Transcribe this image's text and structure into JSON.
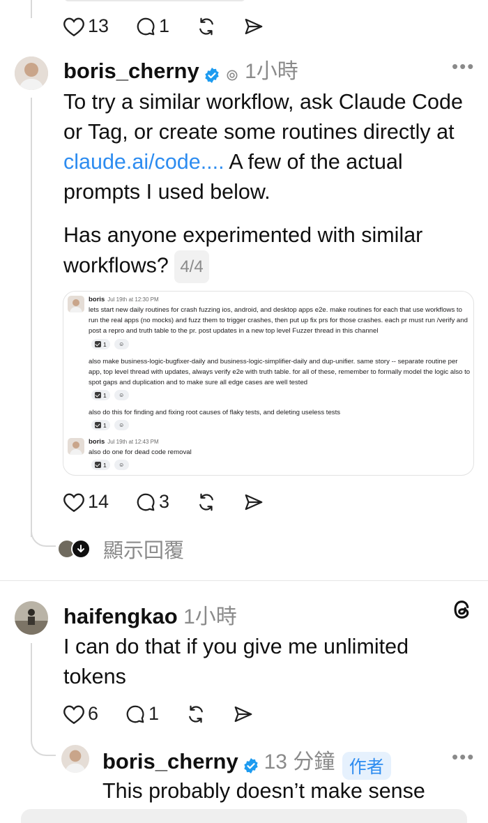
{
  "top_actions": {
    "likes": "13",
    "replies": "1"
  },
  "post1": {
    "username": "boris_cherny",
    "time": "1小時",
    "text_a": "To try a similar workflow, ask Claude Code or Tag, or create some routines directly at ",
    "link": "claude.ai/code....",
    "text_b": " A few of the actual prompts I used below.",
    "text2": "Has anyone experimented with similar workflows? ",
    "page_indicator": "4/4",
    "likes": "14",
    "replies": "3",
    "show_replies": "顯示回覆"
  },
  "slack": {
    "msg1_name": "boris",
    "msg1_time": "Jul 19th at 12:30 PM",
    "msg1_text": "lets start new daily routines for crash fuzzing ios, android, and desktop apps e2e. make routines for each that use workflows to run the real apps (no mocks) and fuzz them to trigger crashes, then put up fix prs for those crashes. each pr must run /verify and post a repro and truth table to the pr. post updates in a new top level Fuzzer thread in this channel",
    "msg2_text": "also make business-logic-bugfixer-daily and business-logic-simplifier-daily and  dup-unifier. same story -- separate routine per app, top level thread with updates, always verify e2e with truth table. for all of these, remember to formally model the logic also to spot gaps and duplication and to make sure all edge cases are well tested",
    "msg3_text": "also do this for finding and fixing root causes of flaky tests, and deleting useless tests",
    "msg4_name": "boris",
    "msg4_time": "Jul 19th at 12:43 PM",
    "msg4_text": "also do one for dead code removal",
    "reaction_count": "1"
  },
  "post2": {
    "username": "haifengkao",
    "time": "1小時",
    "text": "I can do that if you give me unlimited tokens",
    "likes": "6",
    "replies": "1"
  },
  "post3": {
    "username": "boris_cherny",
    "time": "13 分鐘",
    "author_badge": "作者",
    "text": "This probably doesn’t make sense"
  },
  "colors": {
    "accent": "#2d8cf0",
    "verified": "#1d9bf0",
    "muted": "#8a8a8a"
  }
}
